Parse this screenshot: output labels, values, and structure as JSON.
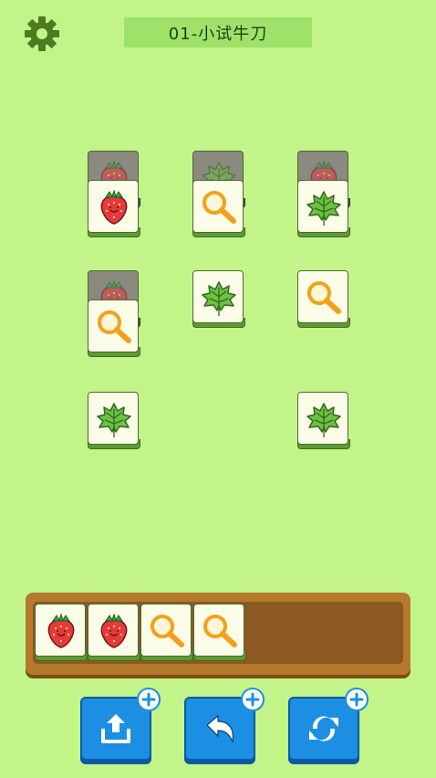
{
  "header": {
    "level_title": "01-小试牛刀",
    "settings_icon": "gear-icon"
  },
  "colors": {
    "background": "#c3f48a",
    "title_bar": "#9fe26a",
    "tray": "#b57a2c",
    "tool_button": "#1c8fe3"
  },
  "board_tiles": [
    {
      "icon": "strawberry-icon",
      "state": "covered"
    },
    {
      "icon": "leaf-icon",
      "state": "covered"
    },
    {
      "icon": "strawberry-icon",
      "state": "covered"
    },
    {
      "icon": "strawberry-icon",
      "state": "open"
    },
    {
      "icon": "magnifier-icon",
      "state": "open"
    },
    {
      "icon": "leaf-icon",
      "state": "open"
    },
    {
      "icon": "strawberry-icon",
      "state": "covered"
    },
    {
      "icon": "leaf-icon",
      "state": "open"
    },
    {
      "icon": "magnifier-icon",
      "state": "open"
    },
    {
      "icon": "magnifier-icon",
      "state": "open"
    },
    {
      "icon": "leaf-icon",
      "state": "open"
    },
    {
      "icon": "leaf-icon",
      "state": "open"
    }
  ],
  "tray_tiles": [
    "strawberry-icon",
    "strawberry-icon",
    "magnifier-icon",
    "magnifier-icon"
  ],
  "tray_capacity": 7,
  "tools": [
    {
      "name": "move-out-icon",
      "add": "plus-icon"
    },
    {
      "name": "undo-icon",
      "add": "plus-icon"
    },
    {
      "name": "shuffle-icon",
      "add": "plus-icon"
    }
  ]
}
